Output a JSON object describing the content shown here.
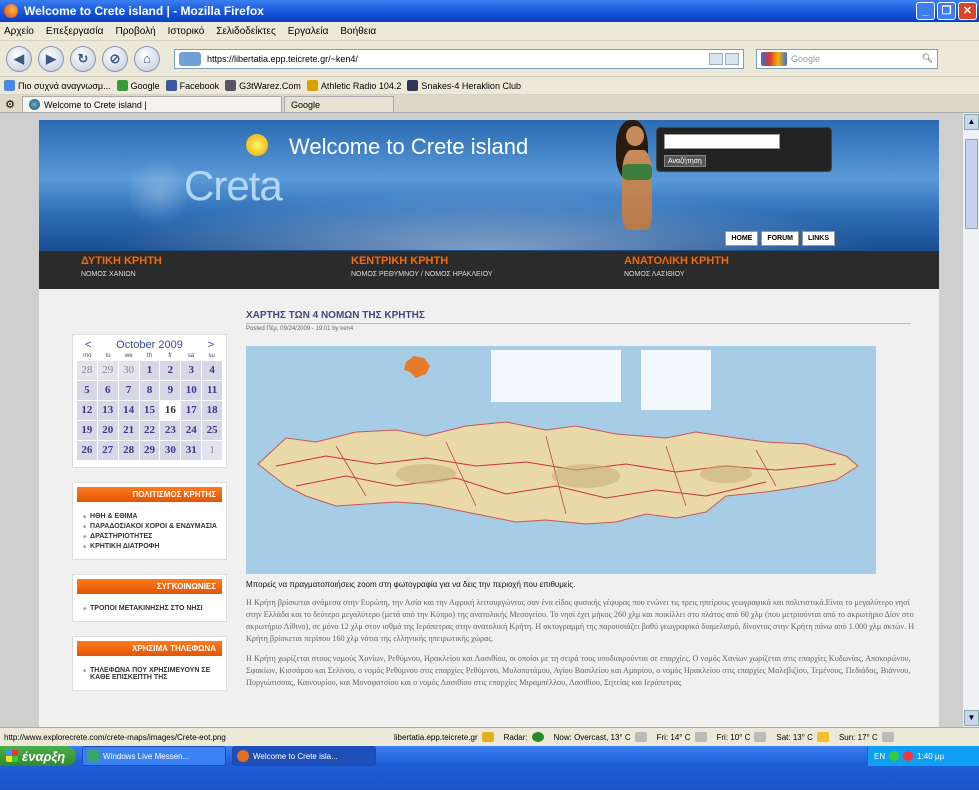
{
  "window": {
    "title": "Welcome to Crete island | - Mozilla Firefox"
  },
  "menu": [
    "Αρχείο",
    "Επεξεργασία",
    "Προβολή",
    "Ιστορικό",
    "Σελιδοδείκτες",
    "Εργαλεία",
    "Βοήθεια"
  ],
  "nav": {
    "url": "https://libertatia.epp.teicrete.gr/~ken4/",
    "search_placeholder": "Google"
  },
  "bookmarks": [
    {
      "label": "Πιο συχνά αναγνωσμ...",
      "color": "#4a8be0"
    },
    {
      "label": "Google",
      "color": "#3a9a3a"
    },
    {
      "label": "Facebook",
      "color": "#3b5998"
    },
    {
      "label": "G3tWarez.Com",
      "color": "#556"
    },
    {
      "label": "Athletic Radio 104.2",
      "color": "#d8a000"
    },
    {
      "label": "Snakes-4 Heraklion Club",
      "color": "#335"
    }
  ],
  "tabs": [
    {
      "label": "Welcome to Crete island |"
    },
    {
      "label": "Google"
    }
  ],
  "site": {
    "title": "Welcome to Crete island",
    "logo": "Creta",
    "search_button": "Αναζήτηση",
    "top_nav": [
      "HOME",
      "FORUM",
      "LINKS"
    ],
    "regions": [
      {
        "title": "ΔΥΤΙΚΗ ΚΡΗΤΗ",
        "sub": "ΝΟΜΟΣ ΧΑΝΙΩΝ"
      },
      {
        "title": "ΚΕΝΤΡΙΚΗ ΚΡΗΤΗ",
        "sub": "ΝΟΜΟΣ ΡΕΘΥΜΝΟΥ / ΝΟΜΟΣ ΗΡΑΚΛΕΙΟΥ"
      },
      {
        "title": "ΑΝΑΤΟΛΙΚΗ ΚΡΗΤΗ",
        "sub": "ΝΟΜΟΣ ΛΑΣΙΘΙΟΥ"
      }
    ],
    "calendar": {
      "month": "October 2009",
      "prev": "<",
      "next": ">",
      "dow": [
        "mo",
        "tu",
        "we",
        "th",
        "fr",
        "sa",
        "su"
      ],
      "days": [
        "28",
        "29",
        "30",
        "1",
        "2",
        "3",
        "4",
        "5",
        "6",
        "7",
        "8",
        "9",
        "10",
        "11",
        "12",
        "13",
        "14",
        "15",
        "16",
        "17",
        "18",
        "19",
        "20",
        "21",
        "22",
        "23",
        "24",
        "25",
        "26",
        "27",
        "28",
        "29",
        "30",
        "31",
        "1"
      ]
    },
    "boxes": [
      {
        "title": "ΠΟΛΙΤΙΣΜΟΣ ΚΡΗΤΗΣ",
        "items": [
          "ΗΘΗ & ΕΘΙΜΑ",
          "ΠΑΡΑΔΟΣΙΑΚΟΙ ΧΟΡΟΙ & ΕΝΔΥΜΑΣΙΑ",
          "ΔΡΑΣΤΗΡΙΟΤΗΤΕΣ",
          "ΚΡΗΤΙΚΗ ΔΙΑΤΡΟΦΗ"
        ]
      },
      {
        "title": "ΣΥΓΚΟΙΝΩΝΙΕΣ",
        "items": [
          "ΤΡΟΠΟΙ ΜΕΤΑΚΙΝΗΣΗΣ ΣΤΟ ΝΗΣΙ"
        ]
      },
      {
        "title": "ΧΡΗΣΙΜΑ ΤΗΛΕΦΩΝΑ",
        "items": [
          "ΤΗΛΕΦΩΝΑ ΠΟΥ ΧΡΗΣΙΜΕΥΟΥΝ ΣΕ ΚΑΘΕ ΕΠΙΣΚΕΠΤΗ ΤΗΣ"
        ]
      }
    ],
    "post": {
      "title": "ΧΑΡΤΗΣ ΤΩΝ 4 ΝΟΜΩΝ ΤΗΣ ΚΡΗΤΗΣ",
      "meta": "Posted Πέμ, 09/24/2009 - 19:01 by ken4",
      "caption": "Μπορείς να πραγματοποιήσεις zoom στη φωτογραφία για να δεις την περιοχή που επιθυμείς.",
      "para1": "Η Κρήτη βρίσκεται ανάμεσα στην Ευρώπη, την Ασία και την Αφρική λειτουργώντας σαν ένα είδος φυσικής γέφυρας που ενώνει τις τρεις ηπείρους γεωγραφικά και πολιτιστικά.Είναι το μεγαλύτερο νησί στην Ελλάδα και το δεύτερο μεγαλύτερο (μετά από την Κύπρο) της ανατολικής Μεσογείου. Το νησί έχει μήκος 260 χλμ και ποικίλλει στο πλάτος από 60 χλμ (που μετριούνται από το ακρωτήριο Δίον στο ακρωτήριο Λίθινο), σε μόνο 12 χλμ στον ισθμό της Ιεράπετρας στην ανατολική Κρήτη. Η ακτογραμμή της παρουσιάζει βαθύ γεωγραφικό διαμελισμό, δίνοντας στην Κρήτη πάνω από 1.000 χλμ ακτών. Η Κρήτη βρίσκεται περίπου 160 χλμ νότια της ελληνικής ηπειρωτικής χώρας.",
      "para2": "Η Κρήτη χωρίζεται στους νομούς Χανίων, Ρεθύμνου, Ηρακλείου και Λασιθίου, οι οποίοι με τη σειρά τους υποδιαιρούνται σε επαρχίες. Ο νομός Χανίων χωρίζεται στις επαρχίες Κυδωνίας, Αποκορώνου, Σφακίων, Κισσάμου και Σελίνου, ο νομός Ρεθύμνου στις επαρχίες Ρεθύμνου, Μυλοποτάμου, Αγίου Βασιλείου και Αμαρίου, ο νομός Ηρακλείου στις επαρχίες Μαλεβιζίου, Τεμένους, Πεδιάδος, Βιάννου, Πυργιώτισσας, Καινουρίου, και Μονοφατσίου και ο νομός Λασιθίου στις επαρχίες Μιραμπέλλου, Λασιθίου, Σητείας και Ιεράπετρας"
    }
  },
  "status": {
    "url": "http://www.explorecrete.com/crete-maps/images/Crete-eot.png",
    "host": "libertatia.epp.teicrete.gr",
    "radar": "Radar:",
    "now": "Now: Overcast, 13° C",
    "fri1": "Fri: 14° C",
    "fri2": "Fri: 10° C",
    "sat": "Sat: 13° C",
    "sun": "Sun: 17° C"
  },
  "taskbar": {
    "start": "έναρξη",
    "items": [
      "Windows Live Messen...",
      "Welcome to Crete isla..."
    ],
    "tray_lang": "EN",
    "clock": "1:40 μμ"
  }
}
